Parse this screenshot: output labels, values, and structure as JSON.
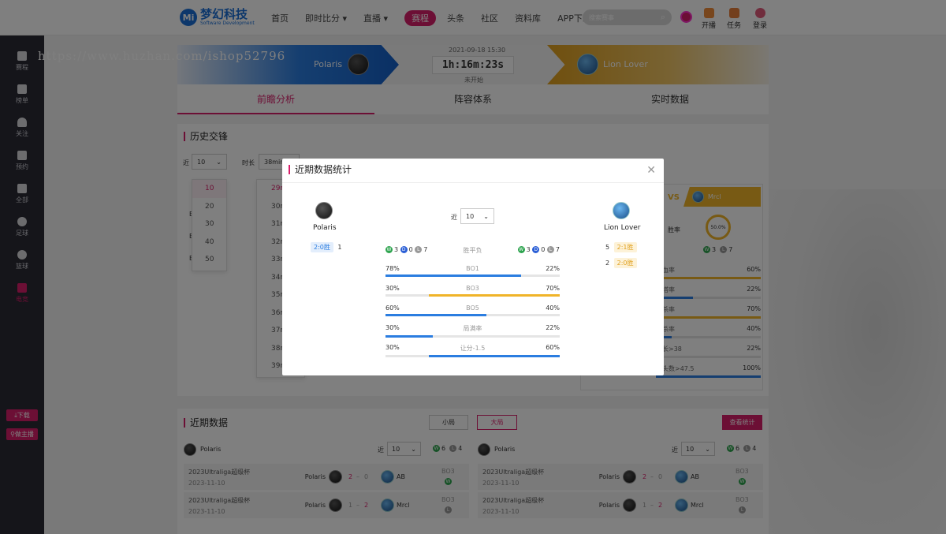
{
  "watermark": "https://www.huzhan.com/ishop52796",
  "header": {
    "logo_text": "梦幻科技",
    "logo_sub": "Software Development",
    "nav": [
      {
        "label": "首页"
      },
      {
        "label": "即时比分"
      },
      {
        "label": "直播"
      },
      {
        "label": "赛程",
        "active": true
      },
      {
        "label": "头条"
      },
      {
        "label": "社区"
      },
      {
        "label": "资料库"
      },
      {
        "label": "APP下载"
      }
    ],
    "search_placeholder": "搜索赛事",
    "tools": [
      {
        "label": "开播",
        "icon": "camera-icon"
      },
      {
        "label": "任务",
        "icon": "box-icon"
      },
      {
        "label": "登录",
        "icon": "user-icon"
      }
    ]
  },
  "sidebar": {
    "items": [
      {
        "label": "赛程",
        "icon": "flag-icon"
      },
      {
        "label": "榜单",
        "icon": "trophy-icon"
      },
      {
        "label": "关注",
        "icon": "heart-icon"
      },
      {
        "label": "预约",
        "icon": "calendar-icon"
      },
      {
        "label": "全部",
        "icon": "grid-icon"
      },
      {
        "label": "足球",
        "icon": "football-icon"
      },
      {
        "label": "篮球",
        "icon": "basketball-icon"
      },
      {
        "label": "电竞",
        "icon": "esports-icon",
        "active": true
      }
    ],
    "download_label": "下载",
    "streamer_label": "做主播"
  },
  "match": {
    "team_a": "Polaris",
    "team_b": "Lion Lover",
    "datetime": "2021-09-18 15:30",
    "countdown": "1h:16m:23s",
    "status": "未开始"
  },
  "tabs": [
    "前瞻分析",
    "阵容体系",
    "实时数据"
  ],
  "history": {
    "title": "历史交锋",
    "near_label": "近",
    "near_value": "10",
    "duration_label": "时长",
    "duration_value": "38min",
    "near_options": [
      "10",
      "20",
      "30",
      "40",
      "50"
    ],
    "duration_options": [
      "29min",
      "30min",
      "31min",
      "32min",
      "33min",
      "34min",
      "35min",
      "36min",
      "37min",
      "38min",
      "39min"
    ],
    "side_team": "Mrcl",
    "win_rate_label": "胜率",
    "win_rate_value": "50.0%",
    "wins": "3",
    "losses": "7",
    "stats": [
      {
        "label": "一血率",
        "value": "60%"
      },
      {
        "label": "一塔率",
        "value": "22%"
      },
      {
        "label": "五杀率",
        "value": "70%"
      },
      {
        "label": "十杀率",
        "value": "40%"
      },
      {
        "label": "时长>38",
        "value": "22%"
      },
      {
        "label": "人头数>47.5",
        "value": "100%"
      }
    ]
  },
  "recent": {
    "title": "近期数据",
    "toggle_small": "小局",
    "toggle_big": "大局",
    "view_stats": "查看统计",
    "left": {
      "team": "Polaris",
      "near_label": "近",
      "near_value": "10",
      "wins": "6",
      "losses": "4",
      "rows": [
        {
          "league": "2023Ultraliga超级杯",
          "date": "2023-11-10",
          "home": "Polaris",
          "score_home": "2",
          "score_away": "0",
          "away": "AB",
          "bo": "BO3",
          "result": "W"
        },
        {
          "league": "2023Ultraliga超级杯",
          "date": "2023-11-10",
          "home": "Polaris",
          "score_home": "1",
          "score_away": "2",
          "away": "Mrcl",
          "bo": "BO3",
          "result": "L"
        }
      ]
    },
    "right": {
      "team": "Polaris",
      "near_label": "近",
      "near_value": "10",
      "wins": "6",
      "losses": "4",
      "rows": [
        {
          "league": "2023Ultraliga超级杯",
          "date": "2023-11-10",
          "home": "Polaris",
          "score_home": "2",
          "score_away": "0",
          "away": "AB",
          "bo": "BO3",
          "result": "W"
        },
        {
          "league": "2023Ultraliga超级杯",
          "date": "2023-11-10",
          "home": "Polaris",
          "score_home": "1",
          "score_away": "2",
          "away": "Mrcl",
          "bo": "BO3",
          "result": "L"
        }
      ]
    }
  },
  "modal": {
    "title": "近期数据统计",
    "near_label": "近",
    "near_value": "10",
    "left_team": "Polaris",
    "right_team": "Lion Lover",
    "left_records": [
      {
        "label": "2:0胜",
        "count": "1"
      }
    ],
    "right_records": [
      {
        "count": "5",
        "label": "2:1胜"
      },
      {
        "count": "2",
        "label": "2:0胜"
      }
    ],
    "summary": {
      "left_w": "3",
      "left_d": "0",
      "left_l": "7",
      "label": "胜平负",
      "right_w": "3",
      "right_d": "0",
      "right_l": "7"
    },
    "rows": [
      {
        "left": "78%",
        "label": "BO1",
        "right": "22%",
        "left_pct": 78,
        "right_pct": 0,
        "color": "blue"
      },
      {
        "left": "30%",
        "label": "BO3",
        "right": "70%",
        "left_pct": 0,
        "right_pct": 75,
        "color": "yellow"
      },
      {
        "left": "60%",
        "label": "BO5",
        "right": "40%",
        "left_pct": 58,
        "right_pct": 0,
        "color": "blue"
      },
      {
        "left": "30%",
        "label": "局满率",
        "right": "22%",
        "left_pct": 27,
        "right_pct": 0,
        "color": "blue"
      },
      {
        "left": "30%",
        "label": "让分-1.5",
        "right": "60%",
        "left_pct": 0,
        "right_pct": 75,
        "color": "blueR"
      }
    ]
  },
  "colors": {
    "accent": "#d91e6a",
    "blue": "#2b7de0",
    "yellow": "#f0b429",
    "sidebar": "#2a2a35"
  }
}
